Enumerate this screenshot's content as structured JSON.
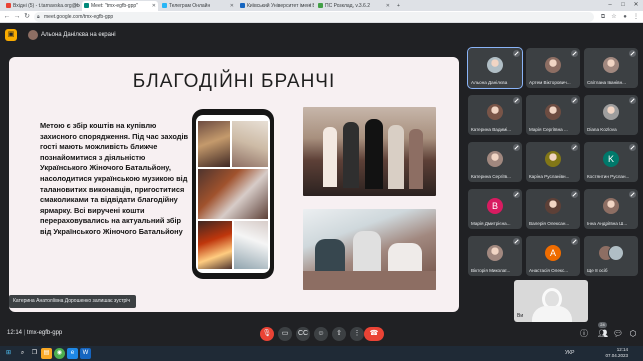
{
  "browser": {
    "tabs": [
      {
        "label": "Вхідні (5) - t.tarnavska.org@bo",
        "favicon_color": "#ea4335"
      },
      {
        "label": "Meet: \"tmx-egfb-gpp\"",
        "favicon_color": "#00897b"
      },
      {
        "label": "Телеграм Онлайн",
        "favicon_color": "#29b6f6"
      },
      {
        "label": "Київський Університет імені Б",
        "favicon_color": "#1565c0"
      },
      {
        "label": "ПС Розклад, v.3.6.2",
        "favicon_color": "#43a047"
      }
    ],
    "new_tab": "+",
    "window_controls": [
      "–",
      "□",
      "✕"
    ],
    "url": "meet.google.com/tmx-egfb-gpp"
  },
  "meet": {
    "presenting_banner": "Альона Данілєва на екрані",
    "slide": {
      "title": "БЛАГОДІЙНІ БРАНЧІ",
      "body": "Метою є збір коштів на купівлю захисного спорядження. Під час заходів гості мають можливість ближче познайомитися з діяльністю Українського Жіночого Батальйону, насолодитися українською музикою від талановитих виконавців, пригоститися смаколиками та відвідати благодійну ярмарку. Всі виручені кошти перераховувались на актуальний збір від Українського Жіночого Батальйону"
    },
    "caption": "Катерина Анатоліївна Дорошенко залишає зустріч",
    "participants": [
      {
        "name": "Альона Данілєва",
        "kind": "photo",
        "color": "#b0bec5"
      },
      {
        "name": "Артем Вікторович...",
        "kind": "photo",
        "color": "#8d6e63"
      },
      {
        "name": "Світлана Іванівн...",
        "kind": "photo",
        "color": "#a1887f"
      },
      {
        "name": "Катерина Вадимі...",
        "kind": "photo",
        "color": "#795548"
      },
      {
        "name": "Марія Сергіївна ...",
        "kind": "photo",
        "color": "#6d4c41"
      },
      {
        "name": "Diana Kozlova",
        "kind": "photo",
        "color": "#9e9e9e"
      },
      {
        "name": "Катерина Сергіїв...",
        "kind": "photo",
        "color": "#a1887f"
      },
      {
        "name": "Каріна Русланівн...",
        "kind": "photo",
        "color": "#827717"
      },
      {
        "name": "Костянтин Руслан...",
        "kind": "initial",
        "initial": "K",
        "color": "#00796b"
      },
      {
        "name": "Марія Дмитрієна...",
        "kind": "initial",
        "initial": "B",
        "color": "#d81b60"
      },
      {
        "name": "Валерія Олексан...",
        "kind": "photo",
        "color": "#5d4037"
      },
      {
        "name": "Інна Андріївна Ш...",
        "kind": "photo",
        "color": "#8d6e63"
      },
      {
        "name": "Вікторія Миколаї...",
        "kind": "photo",
        "color": "#a1887f"
      },
      {
        "name": "Анастасія Олекс...",
        "kind": "initial",
        "initial": "A",
        "color": "#ef6c00"
      },
      {
        "name": "Ще 8 осіб",
        "kind": "group",
        "color": "#9e9e9e"
      }
    ],
    "self_label": "Ви",
    "bottom": {
      "time": "12:14",
      "meeting_code": "tmx-egfb-gpp",
      "participants_count": "24"
    }
  },
  "taskbar": {
    "lang": "УКР",
    "time": "12:14",
    "date": "07.04.2023"
  }
}
